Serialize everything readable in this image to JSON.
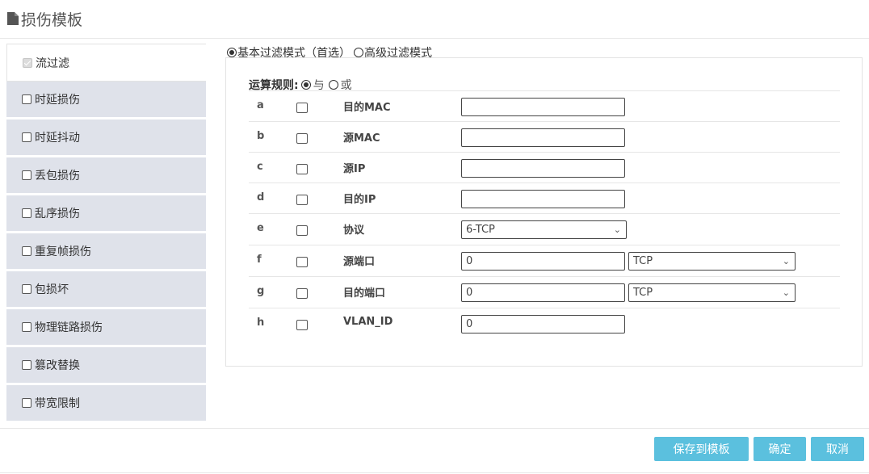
{
  "header": {
    "title": "损伤模板",
    "icon": "document-icon"
  },
  "sidebar": {
    "items": [
      {
        "label": "流过滤",
        "active": true,
        "checked": true
      },
      {
        "label": "时延损伤"
      },
      {
        "label": "时延抖动"
      },
      {
        "label": "丢包损伤"
      },
      {
        "label": "乱序损伤"
      },
      {
        "label": "重复帧损伤"
      },
      {
        "label": "包损坏"
      },
      {
        "label": "物理链路损伤"
      },
      {
        "label": "篡改替换"
      },
      {
        "label": "带宽限制"
      }
    ]
  },
  "mode": {
    "basic_label": "基本过滤模式（首选）",
    "advanced_label": "高级过滤模式",
    "selected": "basic"
  },
  "operation": {
    "label": "运算规则:",
    "and_label": "与",
    "or_label": "或",
    "selected": "and"
  },
  "rows": [
    {
      "letter": "a",
      "name": "目的MAC",
      "value": ""
    },
    {
      "letter": "b",
      "name": "源MAC",
      "value": ""
    },
    {
      "letter": "c",
      "name": "源IP",
      "value": ""
    },
    {
      "letter": "d",
      "name": "目的IP",
      "value": ""
    },
    {
      "letter": "e",
      "name": "协议",
      "select": "6-TCP"
    },
    {
      "letter": "f",
      "name": "源端口",
      "value": "0",
      "select": "TCP"
    },
    {
      "letter": "g",
      "name": "目的端口",
      "value": "0",
      "select": "TCP"
    },
    {
      "letter": "h",
      "name": "VLAN_ID",
      "value": "0"
    }
  ],
  "buttons": {
    "save_template": "保存到模板",
    "confirm": "确定",
    "cancel": "取消"
  },
  "colors": {
    "button": "#5bc0de",
    "sidebar_bg": "#dfe2ea"
  }
}
